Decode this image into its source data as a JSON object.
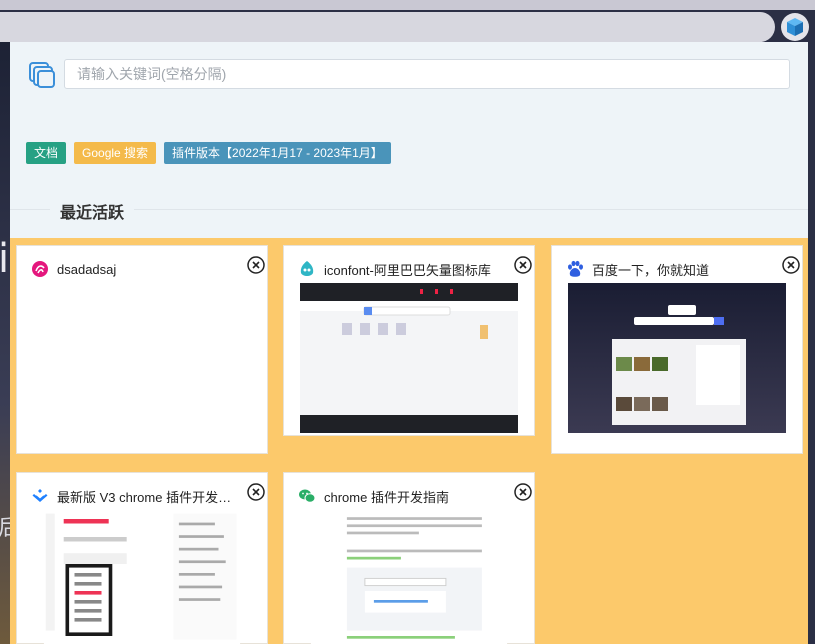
{
  "search": {
    "placeholder": "请输入关键词(空格分隔)"
  },
  "tags": [
    {
      "label": "文档",
      "color": "#26a184"
    },
    {
      "label": "Google 搜索",
      "color": "#f4ba4a"
    },
    {
      "label": "插件版本【2022年1月17 - 2023年1月】",
      "color": "#4a94ba"
    }
  ],
  "section": {
    "title": "最近活跃"
  },
  "colors": {
    "panel_bg": "#eef4f8",
    "grid_bg": "#fcc96b"
  },
  "cards": [
    {
      "title": "dsadadsaj",
      "icon": "magenta-circle-icon"
    },
    {
      "title": "iconfont-阿里巴巴矢量图标库",
      "icon": "iconfont-icon"
    },
    {
      "title": "百度一下，你就知道",
      "icon": "baidu-paw-icon"
    },
    {
      "title": "最新版 V3 chrome 插件开发~ d…",
      "icon": "juejin-icon"
    },
    {
      "title": "chrome 插件开发指南",
      "icon": "wechat-icon"
    }
  ]
}
